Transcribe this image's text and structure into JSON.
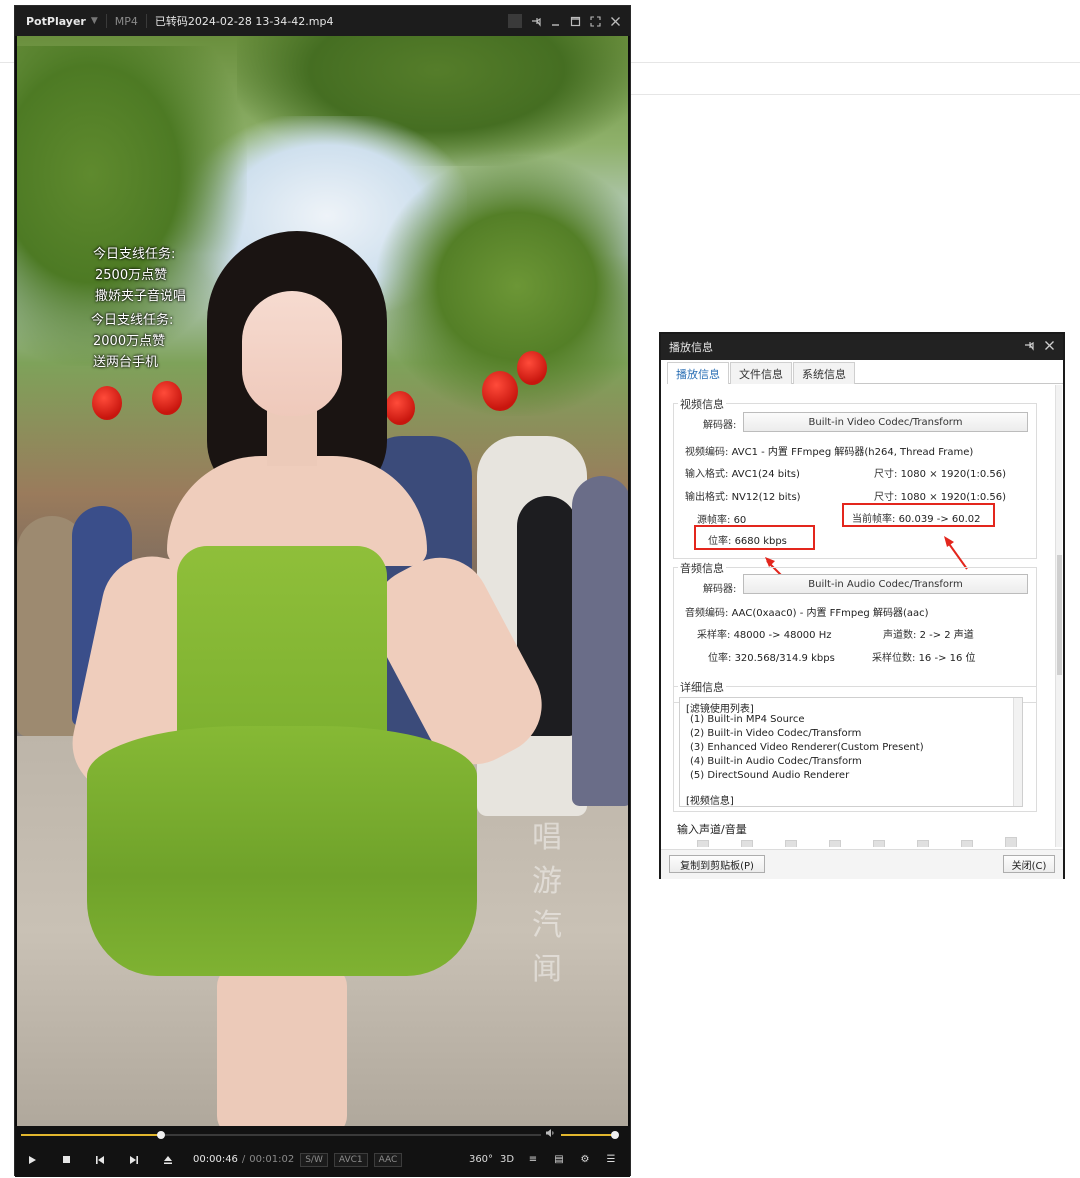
{
  "player": {
    "app_name": "PotPlayer",
    "format": "MP4",
    "file_name": "已转码2024-02-28 13-34-42.mp4",
    "seek_progress": 0.27,
    "volume_level": 1.0,
    "time_current": "00:00:46",
    "time_separator": "/",
    "time_total": "00:01:02",
    "tags": [
      "S/W",
      "AVC1",
      "AAC"
    ],
    "right_controls": [
      "360°",
      "3D",
      "≡",
      "▤",
      "⚙",
      "☰"
    ]
  },
  "video_captions": {
    "line1": "今日支线任务:",
    "line2": "2500万点赞",
    "line3": "撒娇夹子音说唱",
    "line4": "今日支线任务:",
    "line5": "2000万点赞",
    "line6": "送两台手机",
    "watermark": "唱游汽闻"
  },
  "dialog": {
    "title": "播放信息",
    "tabs": [
      "播放信息",
      "文件信息",
      "系统信息"
    ],
    "active_tab": 0,
    "video": {
      "group_title": "视频信息",
      "decoder_label": "解码器:",
      "decoder_value": "Built-in Video Codec/Transform",
      "codec_label": "视频编码:",
      "codec_value": "AVC1 - 内置 FFmpeg 解码器(h264, Thread Frame)",
      "input_label": "输入格式:",
      "input_value": "AVC1(24 bits)",
      "size_label": "尺寸:",
      "size_value": "1080 × 1920(1:0.56)",
      "output_label": "输出格式:",
      "output_value": "NV12(12 bits)",
      "size2_label": "尺寸:",
      "size2_value": "1080 × 1920(1:0.56)",
      "src_fps_label": "源帧率:",
      "src_fps_value": "60",
      "cur_fps_label": "当前帧率:",
      "cur_fps_value": "60.039 -> 60.02",
      "bitrate_label": "位率:",
      "bitrate_value": "6680 kbps"
    },
    "audio": {
      "group_title": "音频信息",
      "decoder_label": "解码器:",
      "decoder_value": "Built-in Audio Codec/Transform",
      "codec_label": "音频编码:",
      "codec_value": "AAC(0xaac0) - 内置 FFmpeg 解码器(aac)",
      "rate_label": "采样率:",
      "rate_value": "48000 -> 48000 Hz",
      "channels_label": "声道数:",
      "channels_value": "2 -> 2 声道",
      "bitrate_label": "位率:",
      "bitrate_value": "320.568/314.9 kbps",
      "bits_label": "采样位数:",
      "bits_value": "16 -> 16 位"
    },
    "details": {
      "group_title": "详细信息",
      "lines": [
        "[滤镜使用列表]",
        "(1) Built-in MP4 Source",
        "(2) Built-in Video Codec/Transform",
        "(3) Enhanced Video Renderer(Custom Present)",
        "(4) Built-in Audio Codec/Transform",
        "(5) DirectSound Audio Renderer",
        "[视频信息]"
      ]
    },
    "input_channels_title": "输入声道/音量",
    "copy_button": "复制到剪贴板(P)",
    "close_button": "关闭(C)"
  }
}
